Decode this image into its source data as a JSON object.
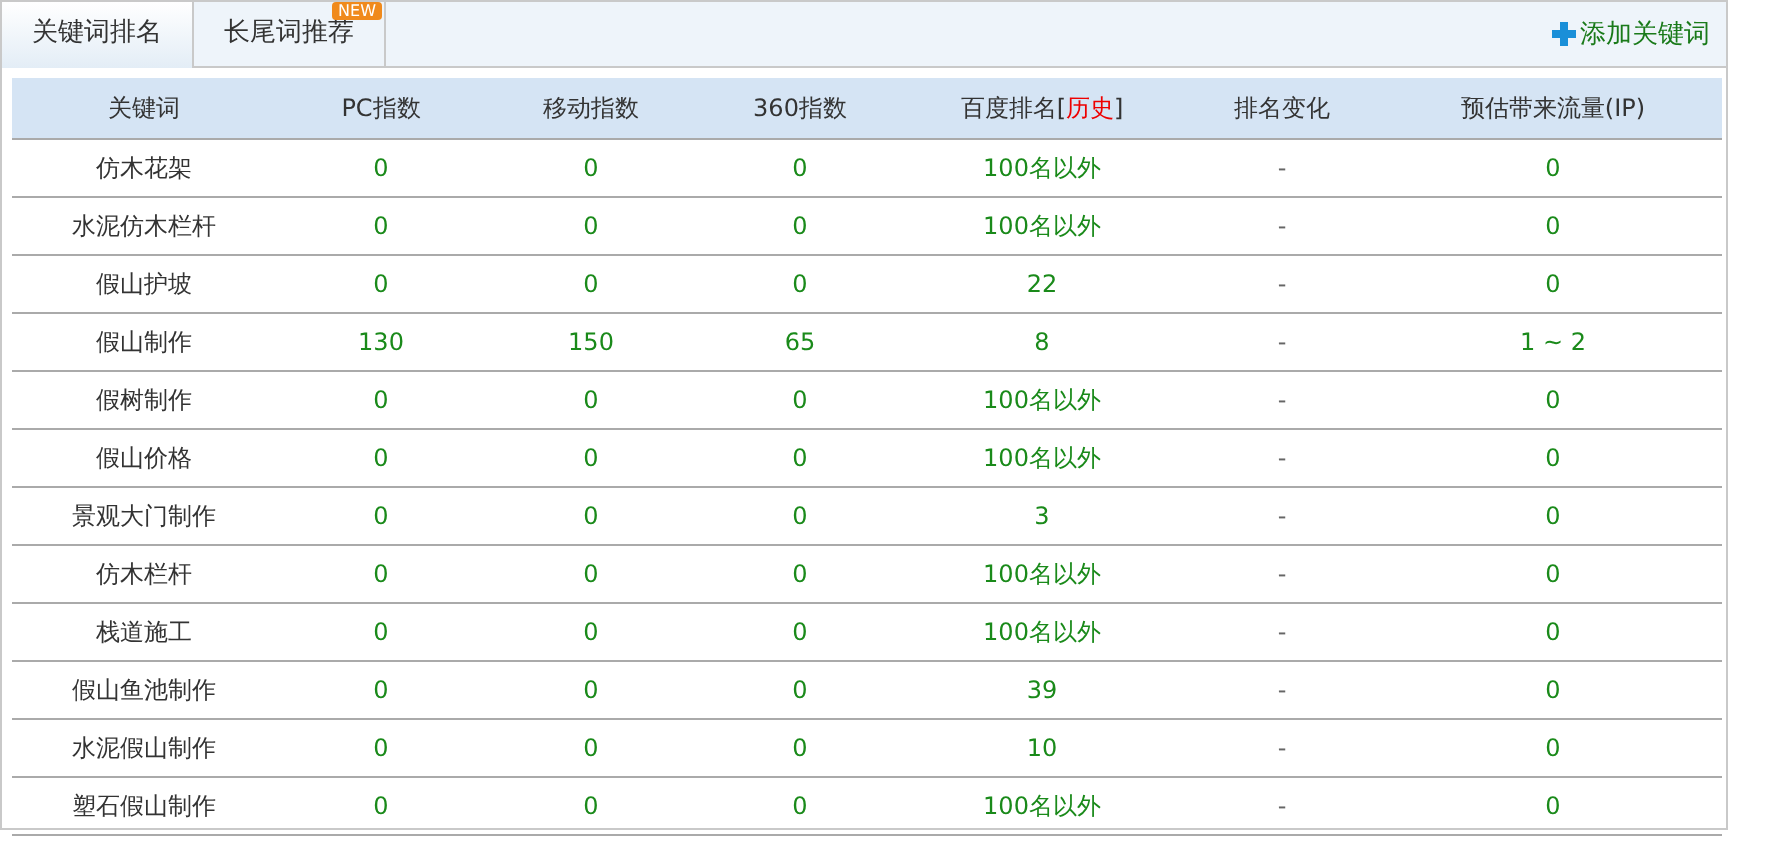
{
  "tabs": [
    {
      "label": "关键词排名",
      "selected": true
    },
    {
      "label": "长尾词推荐",
      "selected": false,
      "badge": "NEW"
    }
  ],
  "add_button": "添加关键词",
  "table": {
    "columns": [
      {
        "label": "关键词"
      },
      {
        "label": "PC指数"
      },
      {
        "label": "移动指数"
      },
      {
        "label": "360指数"
      },
      {
        "label": "百度排名[",
        "link": "历史",
        "suffix": "]"
      },
      {
        "label": "排名变化"
      },
      {
        "label": "预估带来流量(IP)"
      }
    ],
    "rows": [
      [
        "仿木花架",
        "0",
        "0",
        "0",
        "100名以外",
        "-",
        "0"
      ],
      [
        "水泥仿木栏杆",
        "0",
        "0",
        "0",
        "100名以外",
        "-",
        "0"
      ],
      [
        "假山护坡",
        "0",
        "0",
        "0",
        "22",
        "-",
        "0"
      ],
      [
        "假山制作",
        "130",
        "150",
        "65",
        "8",
        "-",
        "1 ~ 2"
      ],
      [
        "假树制作",
        "0",
        "0",
        "0",
        "100名以外",
        "-",
        "0"
      ],
      [
        "假山价格",
        "0",
        "0",
        "0",
        "100名以外",
        "-",
        "0"
      ],
      [
        "景观大门制作",
        "0",
        "0",
        "0",
        "3",
        "-",
        "0"
      ],
      [
        "仿木栏杆",
        "0",
        "0",
        "0",
        "100名以外",
        "-",
        "0"
      ],
      [
        "栈道施工",
        "0",
        "0",
        "0",
        "100名以外",
        "-",
        "0"
      ],
      [
        "假山鱼池制作",
        "0",
        "0",
        "0",
        "39",
        "-",
        "0"
      ],
      [
        "水泥假山制作",
        "0",
        "0",
        "0",
        "10",
        "-",
        "0"
      ],
      [
        "塑石假山制作",
        "0",
        "0",
        "0",
        "100名以外",
        "-",
        "0"
      ]
    ]
  }
}
